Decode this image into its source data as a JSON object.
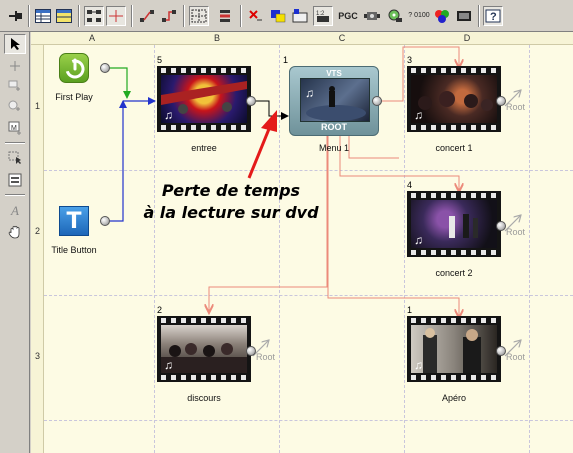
{
  "toolbar": {
    "buttons": [
      {
        "name": "pin-icon"
      },
      {
        "name": "table-view-icon"
      },
      {
        "name": "list-view-icon"
      },
      {
        "name": "tree-layout-icon"
      },
      {
        "name": "connector-icon"
      },
      {
        "name": "link-icon"
      },
      {
        "name": "link-alt-icon"
      },
      {
        "name": "grid-icon"
      },
      {
        "name": "align-icon"
      },
      {
        "name": "delete-link-icon"
      },
      {
        "name": "color-icon"
      },
      {
        "name": "chapter-icon"
      },
      {
        "name": "zoom-icon"
      },
      {
        "name": "pgc-icon"
      },
      {
        "name": "settings-icon"
      },
      {
        "name": "disc-icon"
      },
      {
        "name": "counter-icon"
      },
      {
        "name": "palette-icon"
      },
      {
        "name": "film-icon"
      },
      {
        "name": "help-icon"
      }
    ],
    "pgc_label": "PGC",
    "counter_label": "? 0100"
  },
  "palette": {
    "tools": [
      "pointer-icon",
      "add-icon",
      "add-box-icon",
      "add-circle-icon",
      "add-menu-icon",
      "select-box-icon",
      "insert-icon",
      "text-tool-icon",
      "hand-icon"
    ]
  },
  "grid": {
    "columns": [
      "A",
      "B",
      "C",
      "D"
    ],
    "rows": [
      "1",
      "2",
      "3"
    ]
  },
  "nodes": {
    "first_play": {
      "label": "First Play"
    },
    "title_button": {
      "label": "Title Button",
      "glyph": "T"
    },
    "entree": {
      "num": "5",
      "label": "entree"
    },
    "menu": {
      "num": "1",
      "label": "Menu 1",
      "vts": "VTS",
      "root": "ROOT"
    },
    "concert1": {
      "num": "3",
      "label": "concert 1",
      "root": "Root"
    },
    "concert2": {
      "num": "4",
      "label": "concert 2",
      "root": "Root"
    },
    "discours": {
      "num": "2",
      "label": "discours",
      "root": "Root"
    },
    "apero": {
      "num": "1",
      "label": "Apéro",
      "root": "Root"
    }
  },
  "annotation": {
    "line1": "Perte de temps",
    "line2": "à la lecture sur dvd"
  },
  "colors": {
    "canvas": "#fdfbe4",
    "link_green": "#22aa22",
    "link_blue": "#2233cc",
    "link_salmon": "#ec8a7a",
    "arrow_red": "#e41a1a"
  }
}
